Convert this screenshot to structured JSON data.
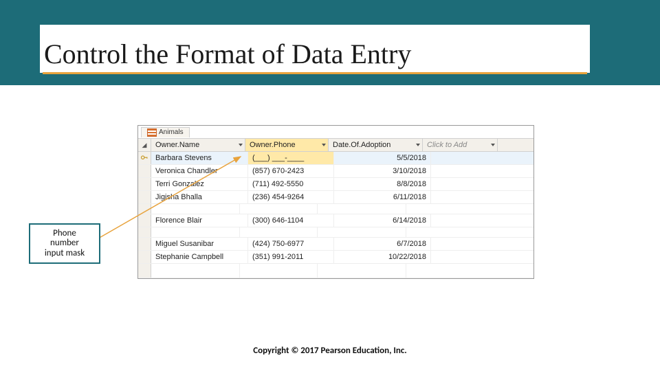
{
  "title": "Control the Format of Data Entry",
  "callout": {
    "line1": "Phone",
    "line2": "number",
    "line3": "input mask"
  },
  "copyright": "Copyright © 2017 Pearson Education, Inc.",
  "datasheet": {
    "tab_label": "Animals",
    "columns": {
      "name": "Owner.Name",
      "phone": "Owner.Phone",
      "date": "Date.Of.Adoption",
      "add": "Click to Add"
    },
    "rows": [
      {
        "name": "Barbara Stevens",
        "phone": "(___) ___-____",
        "date": "5/5/2018",
        "active": true
      },
      {
        "name": "Veronica Chandler",
        "phone": "(857) 670-2423",
        "date": "3/10/2018"
      },
      {
        "name": "Terri Gonzalez",
        "phone": "(711) 492-5550",
        "date": "8/8/2018"
      },
      {
        "name": "Jigisha Bhalla",
        "phone": "(236) 454-9264",
        "date": "6/11/2018"
      }
    ],
    "rows2": [
      {
        "name": "Florence Blair",
        "phone": "(300) 646-1104",
        "date": "6/14/2018"
      }
    ],
    "rows3": [
      {
        "name": "Miguel Susanibar",
        "phone": "(424) 750-6977",
        "date": "6/7/2018"
      },
      {
        "name": "Stephanie Campbell",
        "phone": "(351) 991-2011",
        "date": "10/22/2018"
      }
    ]
  }
}
